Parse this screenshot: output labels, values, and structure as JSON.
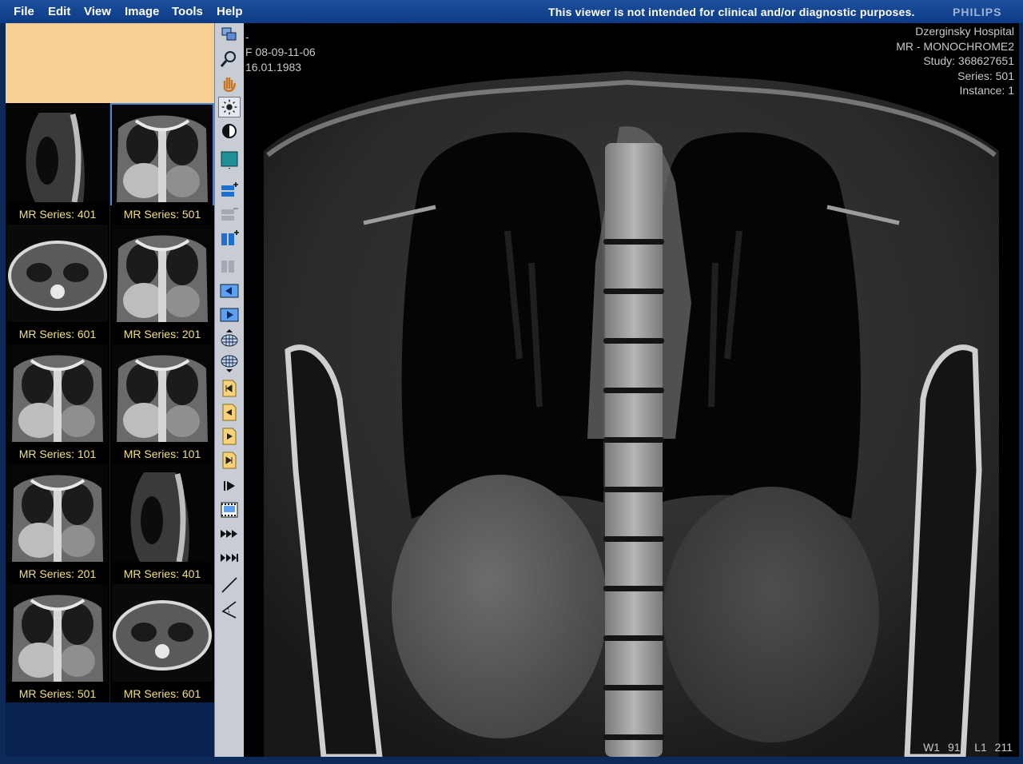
{
  "menubar": {
    "items": [
      "File",
      "Edit",
      "View",
      "Image",
      "Tools",
      "Help"
    ],
    "disclaimer": "This viewer is not intended for clinical and/or diagnostic purposes.",
    "brand": "PHILIPS"
  },
  "thumbnails": [
    {
      "label": "MR Series: 401",
      "view": "sagittal",
      "selected": false
    },
    {
      "label": "MR Series: 501",
      "view": "coronal",
      "selected": true
    },
    {
      "label": "MR Series: 601",
      "view": "axial",
      "selected": false
    },
    {
      "label": "MR Series: 201",
      "view": "coronal",
      "selected": false
    },
    {
      "label": "MR Series: 101",
      "view": "coronal",
      "selected": false
    },
    {
      "label": "MR Series: 101",
      "view": "coronal",
      "selected": false
    },
    {
      "label": "MR Series: 201",
      "view": "coronal",
      "selected": false
    },
    {
      "label": "MR Series: 401",
      "view": "sagittal",
      "selected": false
    },
    {
      "label": "MR Series: 501",
      "view": "coronal",
      "selected": false
    },
    {
      "label": "MR Series: 601",
      "view": "axial",
      "selected": false
    }
  ],
  "toolbar": {
    "tools": [
      {
        "name": "stack-icon",
        "active": false
      },
      {
        "name": "zoom-icon",
        "active": false
      },
      {
        "name": "pan-hand-icon",
        "active": false
      },
      {
        "name": "brightness-icon",
        "active": true
      },
      {
        "name": "invert-icon",
        "active": false
      },
      {
        "name": "single-layout-icon",
        "active": false
      },
      {
        "name": "add-row-icon",
        "active": false
      },
      {
        "name": "remove-row-icon",
        "active": false
      },
      {
        "name": "add-column-icon",
        "active": false
      },
      {
        "name": "remove-column-icon",
        "active": false
      },
      {
        "name": "previous-image-icon",
        "active": false
      },
      {
        "name": "next-image-icon",
        "active": false
      },
      {
        "name": "grid-up-icon",
        "active": false
      },
      {
        "name": "grid-down-icon",
        "active": false
      },
      {
        "name": "first-series-icon",
        "active": false
      },
      {
        "name": "previous-series-icon",
        "active": false
      },
      {
        "name": "next-series-icon",
        "active": false
      },
      {
        "name": "last-series-icon",
        "active": false
      },
      {
        "name": "play-icon",
        "active": false
      },
      {
        "name": "cine-film-icon",
        "active": false
      },
      {
        "name": "fast-forward-icon",
        "active": false
      },
      {
        "name": "skip-forward-icon",
        "active": false
      },
      {
        "name": "measure-line-icon",
        "active": false
      },
      {
        "name": "measure-angle-icon",
        "active": false
      }
    ]
  },
  "viewer": {
    "patient_id_marker": "-",
    "patient_line1": "F 08-09-11-06",
    "patient_line2": "16.01.1983",
    "institution": "Dzerginsky Hospital",
    "modality": "MR - MONOCHROME2",
    "study": "Study: 368627651",
    "series": "Series: 501",
    "instance": "Instance: 1",
    "window_level": "W1 918   L1 211"
  }
}
